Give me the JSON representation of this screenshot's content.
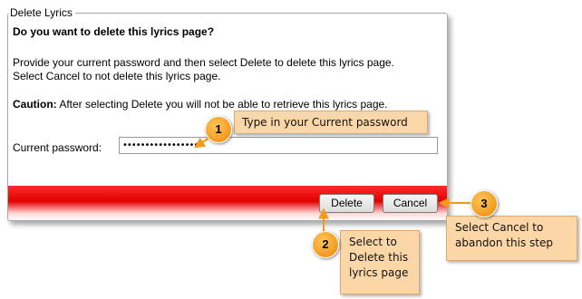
{
  "dialog": {
    "legend": "Delete Lyrics",
    "question": "Do you want to delete this lyrics page?",
    "instructions_line1": "Provide your current password and then select Delete to delete this lyrics page.",
    "instructions_line2": "Select Cancel to not delete this lyrics page.",
    "caution_label": "Caution:",
    "caution_text": " After selecting Delete you will not be able to retrieve this lyrics page.",
    "password_label": "Current password:",
    "password_value": "•••••••••••••••••",
    "delete_label": "Delete",
    "cancel_label": "Cancel"
  },
  "callouts": [
    {
      "number": "1",
      "text": "Type in your Current password"
    },
    {
      "number": "2",
      "text_lines": [
        "Select to",
        "Delete this",
        "lyrics page"
      ]
    },
    {
      "number": "3",
      "text_lines": [
        "Select Cancel to",
        "abandon this step"
      ]
    }
  ],
  "colors": {
    "footer_red": "#e00000",
    "callout_fill": "#fbd7a8",
    "badge_orange": "#f29a1e"
  }
}
